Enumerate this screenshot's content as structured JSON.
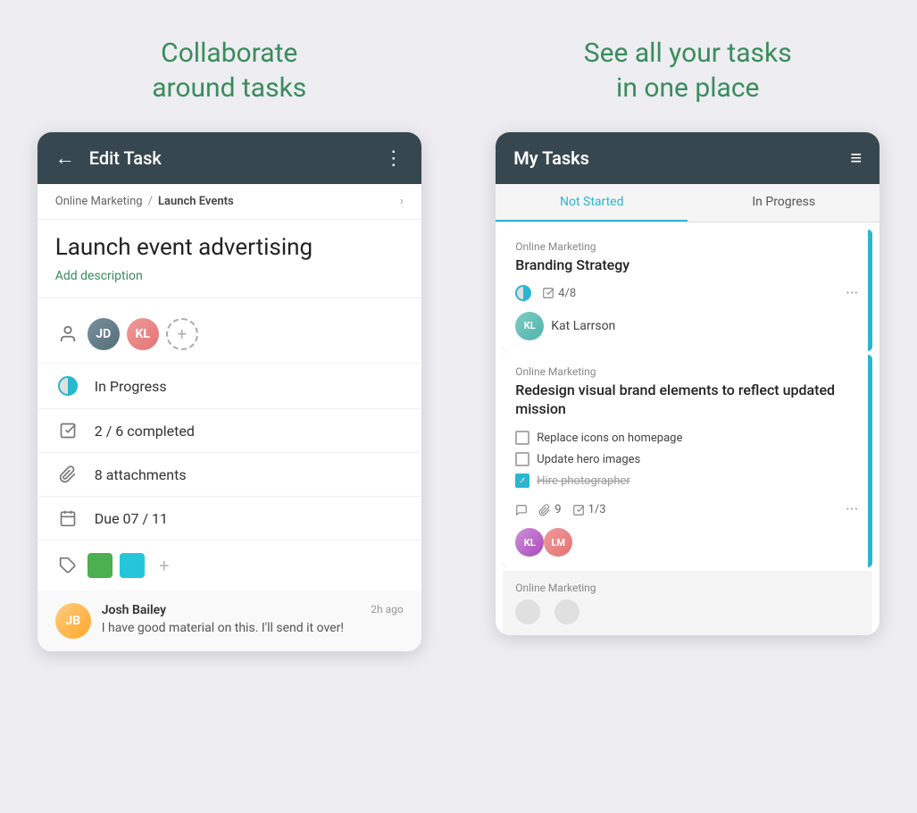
{
  "left_panel": {
    "title": "Collaborate\naround tasks",
    "header": {
      "back_label": "←",
      "title": "Edit Task",
      "menu_icon": "⋮"
    },
    "breadcrumb": {
      "project": "Online Marketing",
      "section": "Launch Events"
    },
    "task_title": "Launch event advertising",
    "add_description": "Add description",
    "status": {
      "label": "In Progress"
    },
    "subtasks": {
      "label": "2 / 6 completed"
    },
    "attachments": {
      "label": "8 attachments"
    },
    "due_date": {
      "label": "Due 07 / 11"
    },
    "comment": {
      "author": "Josh Bailey",
      "time": "2h ago",
      "text": "I have good material on this. I'll send it over!"
    }
  },
  "right_panel": {
    "title": "See all your tasks\nin one place",
    "header": {
      "title": "My Tasks",
      "filter_icon": "≡"
    },
    "tabs": [
      {
        "label": "Not Started",
        "active": true
      },
      {
        "label": "In Progress",
        "active": false
      }
    ],
    "tasks": [
      {
        "category": "Online Marketing",
        "title": "Branding Strategy",
        "meta_status": "half",
        "meta_subtasks": "4/8",
        "assignee": "Kat Larrson",
        "has_accent": true
      },
      {
        "category": "Online Marketing",
        "title": "Redesign visual brand elements to reflect updated mission",
        "subtasks": [
          {
            "text": "Replace icons on homepage",
            "done": false
          },
          {
            "text": "Update hero images",
            "done": false
          },
          {
            "text": "Hire photographer",
            "done": true
          }
        ],
        "meta_comments": "●",
        "meta_attachments": "9",
        "meta_subtasks": "1/3",
        "assignees": [
          "K",
          "L"
        ],
        "has_accent": true
      }
    ],
    "partial": {
      "category": "Online Marketing"
    }
  }
}
